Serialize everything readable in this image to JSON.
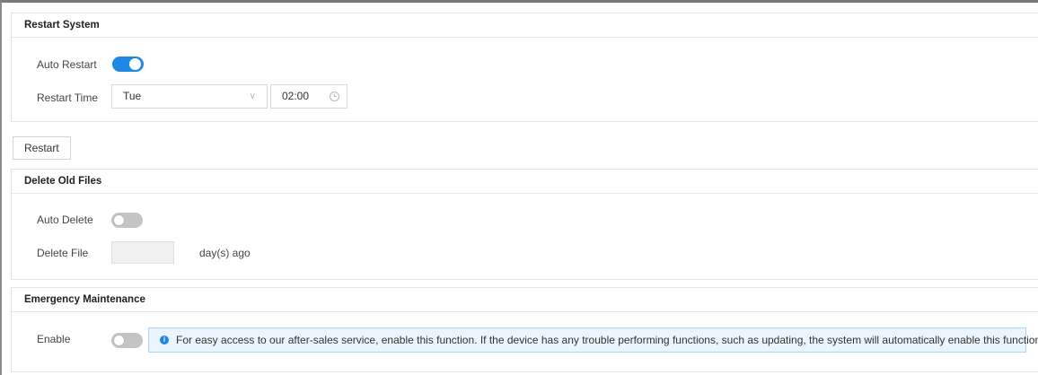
{
  "restart_system": {
    "title": "Restart System",
    "auto_restart_label": "Auto Restart",
    "auto_restart_enabled": true,
    "restart_time_label": "Restart Time",
    "day_value": "Tue",
    "time_value": "02:00",
    "icons": {
      "day_dropdown": "chevron-down-icon",
      "time_picker": "clock-icon"
    }
  },
  "restart_button_label": "Restart",
  "delete_old_files": {
    "title": "Delete Old Files",
    "auto_delete_label": "Auto Delete",
    "auto_delete_enabled": false,
    "delete_file_label": "Delete File",
    "days_value": "",
    "days_suffix": "day(s) ago"
  },
  "emergency_maintenance": {
    "title": "Emergency Maintenance",
    "enable_label": "Enable",
    "enabled": false,
    "info_text": "For easy access to our after-sales service, enable this function. If the device has any trouble performing functions, such as updating, the system will automatically enable this function.",
    "info_icon": "info-icon"
  },
  "colors": {
    "accent": "#1e88e5",
    "toggle_off": "#c4c4c4",
    "info_background": "#eaf5fd",
    "info_border": "#a7d6fa"
  }
}
